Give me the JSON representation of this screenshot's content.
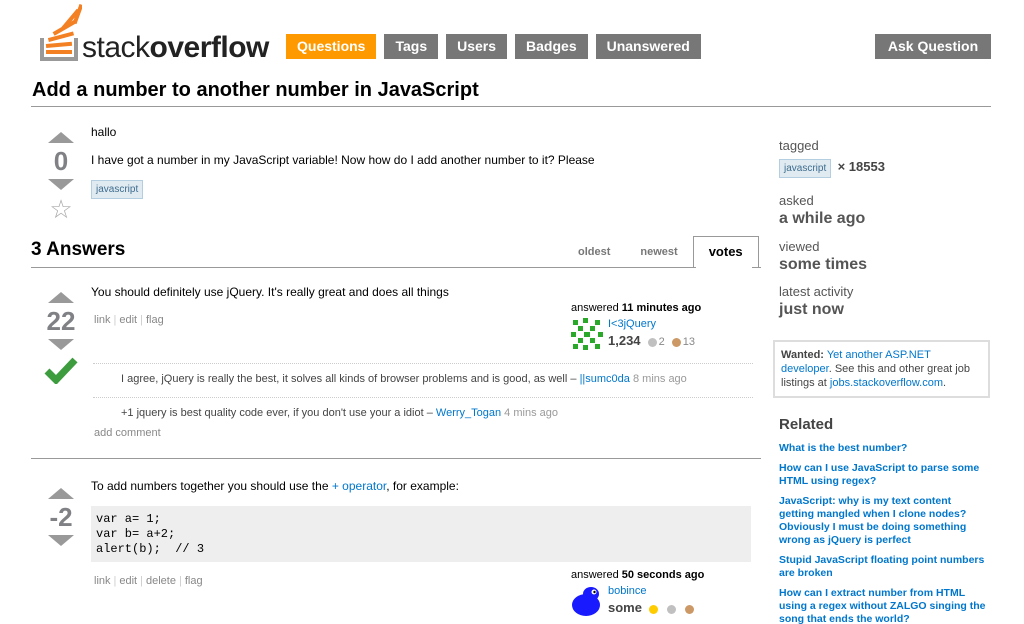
{
  "header": {
    "logo_plain": "stack",
    "logo_bold": "overflow",
    "nav": [
      "Questions",
      "Tags",
      "Users",
      "Badges",
      "Unanswered"
    ],
    "ask_label": "Ask Question"
  },
  "question": {
    "title": "Add a number to another number in JavaScript",
    "votes": "0",
    "body_line1": "hallo",
    "body_line2": "I have got a number in my JavaScript variable! Now how do I add another number to it? Please",
    "tag": "javascript"
  },
  "answers_header": {
    "count_label": "3 Answers",
    "tabs": [
      "oldest",
      "newest",
      "votes"
    ],
    "active_tab": "votes"
  },
  "answer1": {
    "votes": "22",
    "text": "You should definitely use jQuery. It's really great and does all things",
    "menu": [
      "link",
      "edit",
      "flag"
    ],
    "answered_label": "answered",
    "answered_time": "11 minutes ago",
    "user": "I<3jQuery",
    "rep": "1,234",
    "silver": "2",
    "bronze": "13",
    "comments": [
      {
        "text": "I agree, jQuery is really the best, it solves all kinds of browser problems and is good, as well –",
        "user": "||sumc0da",
        "time": "8 mins ago"
      },
      {
        "text": "+1 jquery is best quality code ever, if you don't use your a idiot –",
        "user": "Werry_Togan",
        "time": "4 mins ago"
      }
    ],
    "add_comment": "add comment"
  },
  "answer2": {
    "votes": "-2",
    "text_before": "To add numbers together you should use the",
    "text_link": "+ operator",
    "text_after": ", for example:",
    "code": "var a= 1;\nvar b= a+2;\nalert(b);  // 3",
    "menu": [
      "link",
      "edit",
      "delete",
      "flag"
    ],
    "answered_label": "answered",
    "answered_time": "50 seconds ago",
    "user": "bobince",
    "rep": "some"
  },
  "sidebar": {
    "tagged_label": "tagged",
    "tag": "javascript",
    "tag_count": "× 18553",
    "asked_label": "asked",
    "asked_value": "a while ago",
    "viewed_label": "viewed",
    "viewed_value": "some times",
    "activity_label": "latest activity",
    "activity_value": "just now",
    "wanted_label": "Wanted:",
    "wanted_link": "Yet another ASP.NET developer",
    "wanted_rest": ". See this and other great job listings at",
    "wanted_site": "jobs.stackoverflow.com",
    "wanted_end": ".",
    "related_title": "Related",
    "related": [
      "What is the best number?",
      "How can I use JavaScript to parse some HTML using regex?",
      "JavaScript: why is my text content getting mangled when I clone nodes? Obviously I must be doing something wrong as jQuery is perfect",
      "Stupid JavaScript floating point numbers are broken",
      "How can I extract number from HTML using a regex without ZALGO singing the song that ends the world?"
    ]
  },
  "colors": {
    "accent": "#ff9900",
    "nav_bg": "#777777",
    "link": "#0077cc",
    "accepted": "#3d9c3d"
  }
}
